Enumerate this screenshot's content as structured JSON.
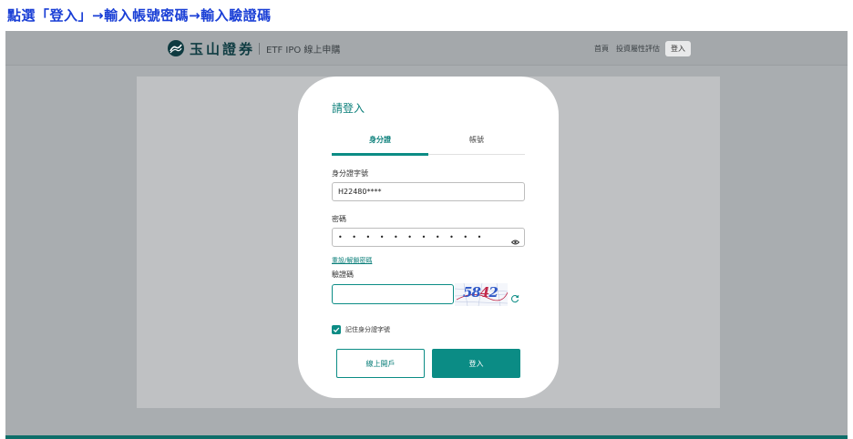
{
  "instruction": "點選「登入」→輸入帳號密碼→輸入驗證碼",
  "header": {
    "brand": "玉山證券",
    "subtitle": "ETF IPO 線上申購",
    "nav": {
      "home": "首頁",
      "risk": "投資屬性評估",
      "login": "登入"
    }
  },
  "login": {
    "title": "請登入",
    "tabs": {
      "id": "身分證",
      "account": "帳號"
    },
    "id_label": "身分證字號",
    "id_value": "H22480****",
    "password_label": "密碼",
    "password_dots": "• • • • • • • • • • •",
    "reset_link": "重設/解鎖密碼",
    "captcha_label": "驗證碼",
    "captcha_value": "",
    "captcha_digits": {
      "a": "58",
      "b": "4",
      "c": "2"
    },
    "remember_label": "記住身分證字號",
    "open_account_button": "線上開戶",
    "login_button": "登入"
  },
  "colors": {
    "accent": "#0b8c85",
    "instruction": "#1a3fd6"
  },
  "icons": {
    "logo": "esun-logo-icon",
    "eye": "eye-icon",
    "refresh": "refresh-icon",
    "check": "check-icon"
  }
}
